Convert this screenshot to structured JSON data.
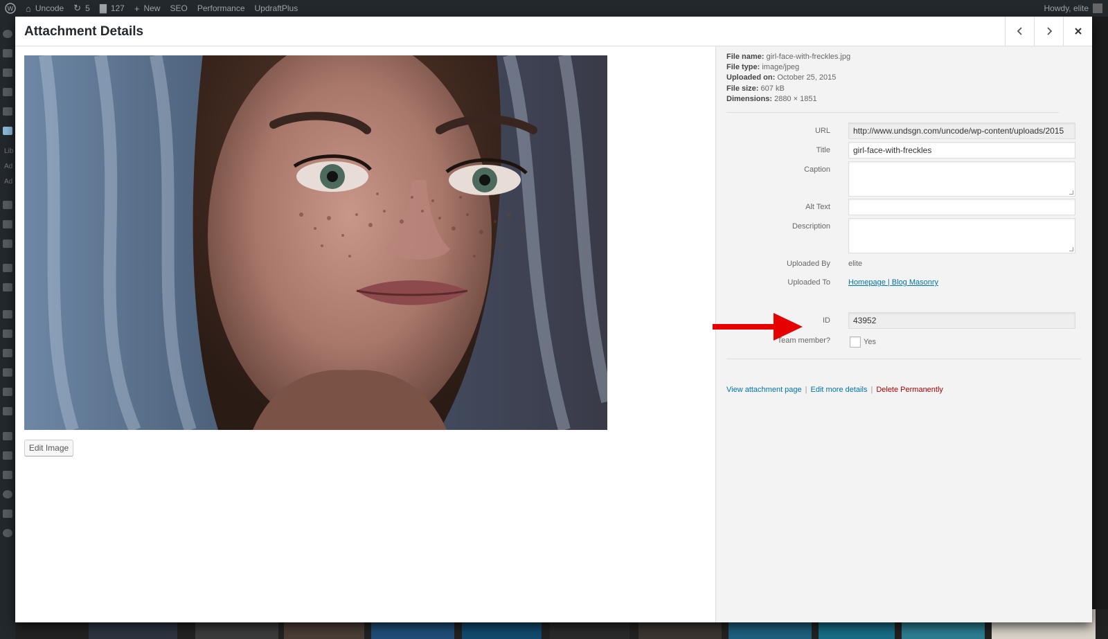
{
  "adminbar": {
    "site_name": "Uncode",
    "updates_count": "5",
    "comments_count": "127",
    "new_label": "New",
    "seo_label": "SEO",
    "performance_label": "Performance",
    "updraft_label": "UpdraftPlus",
    "howdy": "Howdy, elite"
  },
  "adminmenu": {
    "fragments": [
      "Lib",
      "Ad",
      "Ad"
    ]
  },
  "modal": {
    "title": "Attachment Details",
    "prev_icon": "chevron-left-icon",
    "next_icon": "chevron-right-icon",
    "close_icon": "close-icon",
    "edit_image_label": "Edit Image"
  },
  "file_info": {
    "file_name_label": "File name:",
    "file_name": "girl-face-with-freckles.jpg",
    "file_type_label": "File type:",
    "file_type": "image/jpeg",
    "uploaded_on_label": "Uploaded on:",
    "uploaded_on": "October 25, 2015",
    "file_size_label": "File size:",
    "file_size": "607 kB",
    "dimensions_label": "Dimensions:",
    "dimensions": "2880 × 1851"
  },
  "fields": {
    "url_label": "URL",
    "url_value": "http://www.undsgn.com/uncode/wp-content/uploads/2015",
    "title_label": "Title",
    "title_value": "girl-face-with-freckles",
    "caption_label": "Caption",
    "caption_value": "",
    "alt_label": "Alt Text",
    "alt_value": "",
    "description_label": "Description",
    "description_value": "",
    "uploaded_by_label": "Uploaded By",
    "uploaded_by_value": "elite",
    "uploaded_to_label": "Uploaded To",
    "uploaded_to_value": "Homepage | Blog Masonry",
    "id_label": "ID",
    "id_value": "43952",
    "team_label": "Team member?",
    "team_option": "Yes"
  },
  "actions": {
    "view_page": "View attachment page",
    "sep1": "|",
    "edit_more": "Edit more details",
    "sep2": "|",
    "delete": "Delete Permanently"
  },
  "colors": {
    "link": "#0073aa",
    "delete": "#a00000",
    "arrow": "#e60000",
    "adminbar": "#23282d"
  }
}
